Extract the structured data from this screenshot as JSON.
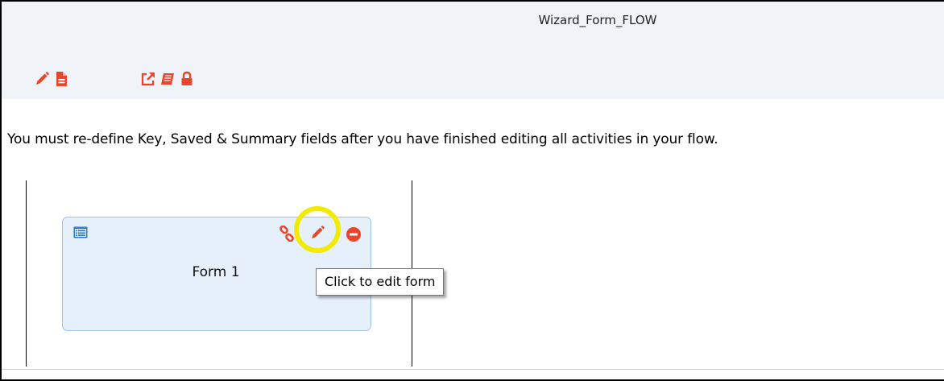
{
  "flow": {
    "title": "Wizard_Form_FLOW"
  },
  "toolbar": {
    "icons": [
      "pencil-icon",
      "document-icon",
      "external-link-icon",
      "book-icon",
      "lock-icon"
    ],
    "accent": "#e8452c"
  },
  "notice": {
    "text": "You must re-define Key, Saved & Summary fields after you have finished editing all activities in your flow."
  },
  "form_node": {
    "name": "Form 1",
    "icons": [
      "form-icon",
      "link-icon",
      "pencil-icon",
      "remove-icon"
    ],
    "background": "#e6f0fb",
    "border": "#9fc3e7"
  },
  "tooltip": {
    "text": "Click to edit form"
  },
  "highlight": {
    "color": "#f2ea00"
  }
}
